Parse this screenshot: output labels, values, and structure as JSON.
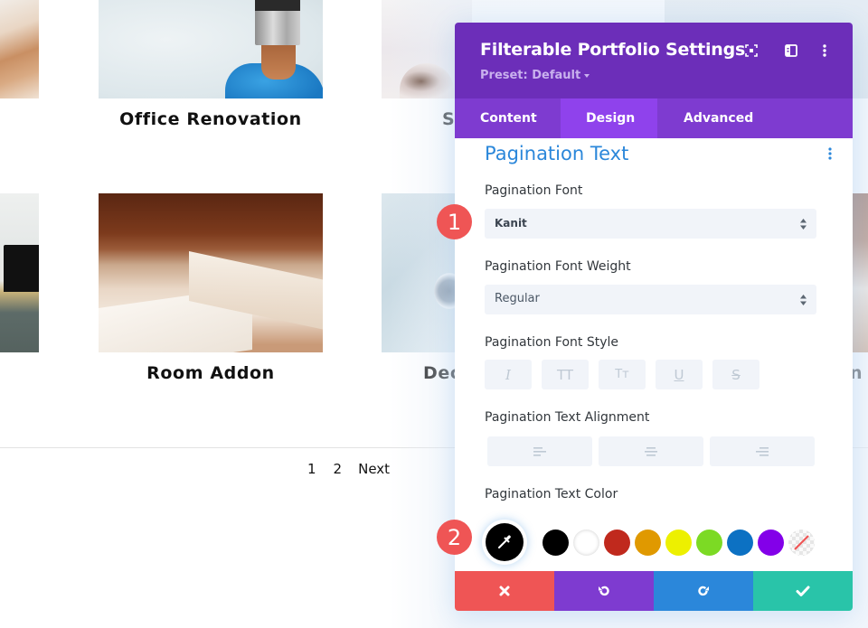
{
  "portfolio": {
    "items": [
      {
        "title": "Office Renovation"
      },
      {
        "title": "S"
      },
      {
        "title": "Room Addon"
      },
      {
        "title": "Dec"
      },
      {
        "title": "n"
      }
    ],
    "pagination": {
      "pages": [
        "1",
        "2"
      ],
      "next_label": "Next"
    }
  },
  "modal": {
    "title": "Filterable Portfolio Settings",
    "preset_label": "Preset: Default",
    "header_icons": [
      "fullscreen-icon",
      "sidebar-layout-icon",
      "more-options-icon"
    ],
    "tabs": [
      {
        "label": "Content",
        "active": false
      },
      {
        "label": "Design",
        "active": true
      },
      {
        "label": "Advanced",
        "active": false
      }
    ],
    "section": {
      "title": "Pagination Text",
      "fields": {
        "font": {
          "label": "Pagination Font",
          "value": "Kanit"
        },
        "font_weight": {
          "label": "Pagination Font Weight",
          "value": "Regular"
        },
        "font_style": {
          "label": "Pagination Font Style",
          "buttons": [
            {
              "name": "italic",
              "glyph": "I"
            },
            {
              "name": "uppercase",
              "glyph": "TT"
            },
            {
              "name": "capitalize",
              "glyph": "Tт"
            },
            {
              "name": "underline",
              "glyph": "U"
            },
            {
              "name": "strikethrough",
              "glyph": "S"
            }
          ]
        },
        "text_alignment": {
          "label": "Pagination Text Alignment",
          "options": [
            "left",
            "center",
            "right"
          ]
        },
        "text_color": {
          "label": "Pagination Text Color",
          "current": "#000000",
          "swatches": [
            "#000000",
            "#ffffff",
            "#c0291d",
            "#e09900",
            "#edf000",
            "#7cda24",
            "#0c71c3",
            "#8300e9",
            "transparent"
          ]
        }
      }
    },
    "footer": {
      "cancel": "cancel",
      "undo": "undo",
      "redo": "redo",
      "save": "save"
    }
  },
  "callouts": [
    "1",
    "2"
  ],
  "colors": {
    "header_purple": "#6c2eb9",
    "tab_purple": "#7e3bd0",
    "tab_active": "#8f42ec",
    "accent_blue": "#2b87da",
    "cancel_red": "#ef5555",
    "save_teal": "#29c4a9"
  }
}
